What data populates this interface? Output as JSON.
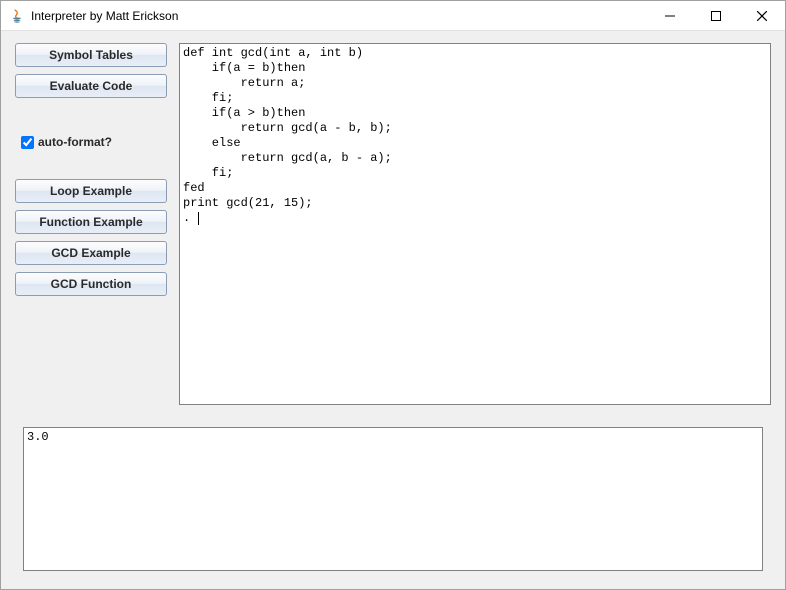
{
  "window": {
    "title": "Interpreter by Matt Erickson"
  },
  "sidebar": {
    "symbol_tables": "Symbol Tables",
    "evaluate_code": "Evaluate Code",
    "auto_format_label": "auto-format?",
    "auto_format_checked": true,
    "loop_example": "Loop Example",
    "function_example": "Function Example",
    "gcd_example": "GCD Example",
    "gcd_function": "GCD Function"
  },
  "editor": {
    "code": "def int gcd(int a, int b)\n    if(a = b)then\n        return a;\n    fi;\n    if(a > b)then\n        return gcd(a - b, b);\n    else\n        return gcd(a, b - a);\n    fi;\nfed\nprint gcd(21, 15);\n. "
  },
  "output": {
    "text": "3.0"
  }
}
